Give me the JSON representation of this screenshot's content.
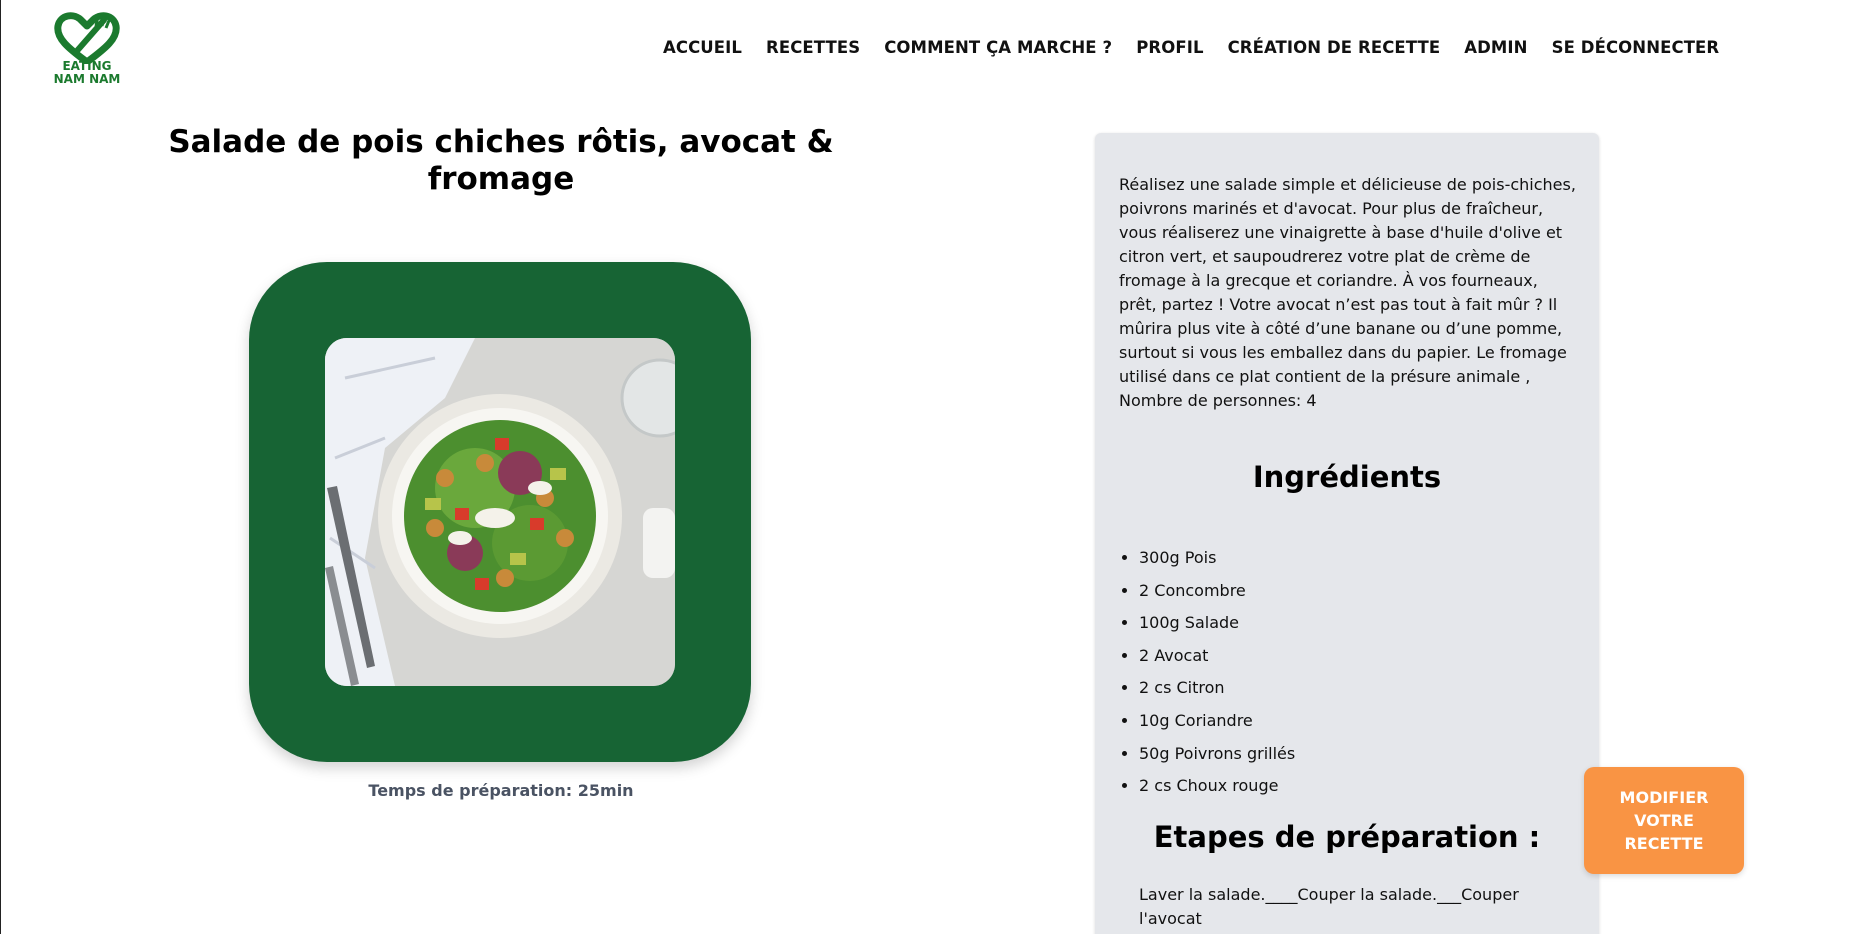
{
  "logo": {
    "line1": "EATING",
    "line2": "NAM NAM",
    "icon": "heart-fork-icon",
    "color": "#1b7a2e"
  },
  "nav": {
    "items": [
      {
        "label": "ACCUEIL"
      },
      {
        "label": "RECETTES"
      },
      {
        "label": "COMMENT ÇA MARCHE ?"
      },
      {
        "label": "PROFIL"
      },
      {
        "label": "CRÉATION DE RECETTE"
      },
      {
        "label": "ADMIN"
      },
      {
        "label": "SE DÉCONNECTER"
      }
    ]
  },
  "recipe": {
    "title": "Salade de pois chiches rôtis, avocat & fromage",
    "image_description": "salad-bowl-photo",
    "prep_time": "Temps de préparation: 25min",
    "description": "Réalisez une salade simple et délicieuse de pois-chiches, poivrons marinés et d'avocat. Pour plus de fraîcheur, vous réaliserez une vinaigrette à base d'huile d'olive et citron vert, et saupoudrerez votre plat de crème de fromage à la grecque et coriandre. À vos fourneaux, prêt, partez ! Votre avocat n’est pas tout à fait mûr ? Il mûrira plus vite à côté d’une banane ou d’une pomme, surtout si vous les emballez dans du papier. Le fromage utilisé dans ce plat contient de la présure animale , Nombre de personnes: 4",
    "ingredients_title": "Ingrédients",
    "ingredients": [
      "300g Pois",
      "2 Concombre",
      "100g Salade",
      "2 Avocat",
      "2 cs Citron",
      "10g Coriandre",
      "50g Poivrons grillés",
      "2 cs Choux rouge"
    ],
    "steps_title": "Etapes de préparation :",
    "steps_text": "Laver la salade.____Couper la salade.___Couper l'avocat"
  },
  "actions": {
    "edit_label": "MODIFIER VOTRE RECETTE"
  },
  "colors": {
    "frame_green": "#176434",
    "panel_bg": "#e5e7eb",
    "button_orange": "#f99444",
    "prep_text": "#4a5363"
  }
}
